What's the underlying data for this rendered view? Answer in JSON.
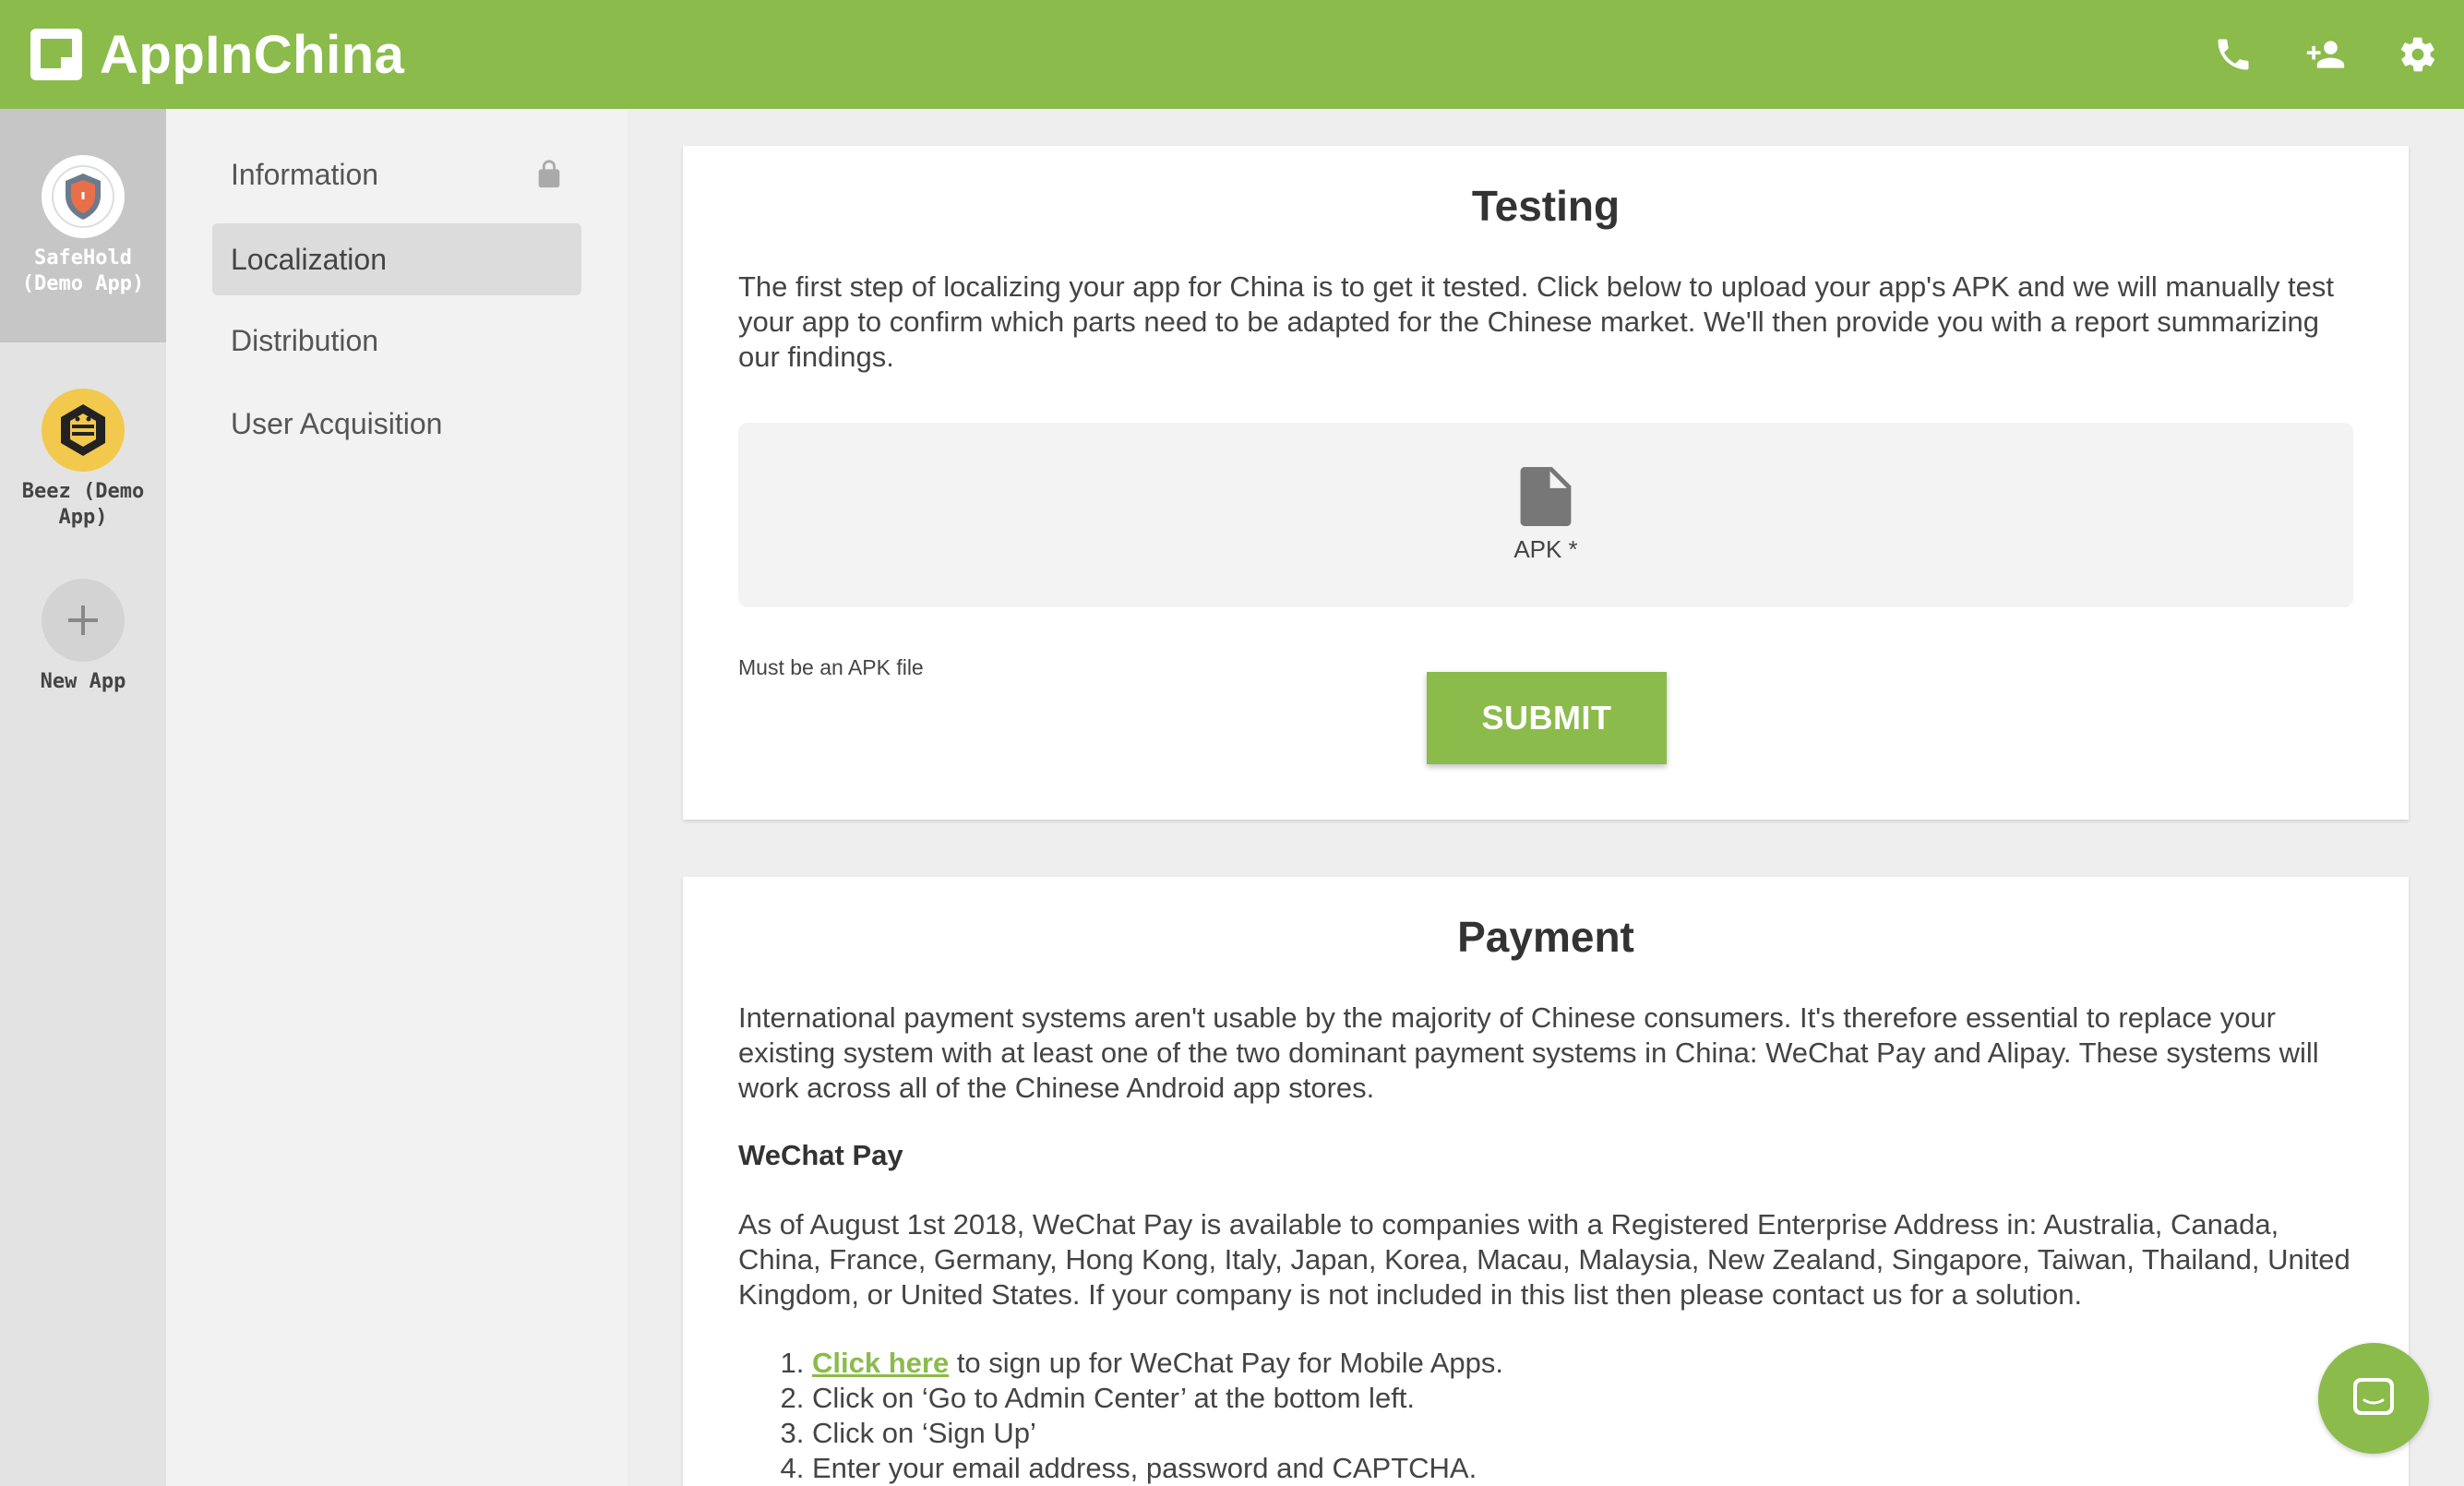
{
  "app": {
    "name": "AppInChina",
    "brand_color": "#8bbb4b",
    "top_icons": [
      "phone-icon",
      "add-user-icon",
      "settings-icon"
    ]
  },
  "rail": {
    "apps": [
      {
        "name": "SafeHold (Demo App)",
        "active": true
      },
      {
        "name": "Beez (Demo App)",
        "active": false
      }
    ],
    "new_app_label": "New App"
  },
  "nav": {
    "items": [
      {
        "label": "Information",
        "locked": true
      },
      {
        "label": "Localization",
        "active": true
      },
      {
        "label": "Distribution"
      },
      {
        "label": "User Acquisition"
      }
    ]
  },
  "testing": {
    "title": "Testing",
    "description": "The first step of localizing your app for China is to get it tested. Click below to upload your app's APK and we will manually test your app to confirm which parts need to be adapted for the Chinese market. We'll then provide you with a report summarizing our findings.",
    "dropzone_label": "APK *",
    "hint": "Must be an APK file",
    "submit_label": "SUBMIT"
  },
  "payment": {
    "title": "Payment",
    "intro": "International payment systems aren't usable by the majority of Chinese consumers. It's therefore essential to replace your existing system with at least one of the two dominant payment systems in China: WeChat Pay and Alipay. These systems will work across all of the Chinese Android app stores.",
    "wechat_heading": "WeChat Pay",
    "wechat_text": "As of August 1st 2018, WeChat Pay is available to companies with a Registered Enterprise Address in: Australia, Canada, China, France, Germany, Hong Kong, Italy, Japan, Korea, Macau, Malaysia, New Zealand, Singapore, Taiwan, Thailand, United Kingdom, or United States. If your company is not included in this list then please contact us for a solution.",
    "step1_link": "Click here",
    "step1_rest": " to sign up for WeChat Pay for Mobile Apps.",
    "step2": "Click on ‘Go to Admin Center’ at the bottom left.",
    "step3": "Click on ‘Sign Up’",
    "step4": "Enter your email address, password and CAPTCHA."
  }
}
